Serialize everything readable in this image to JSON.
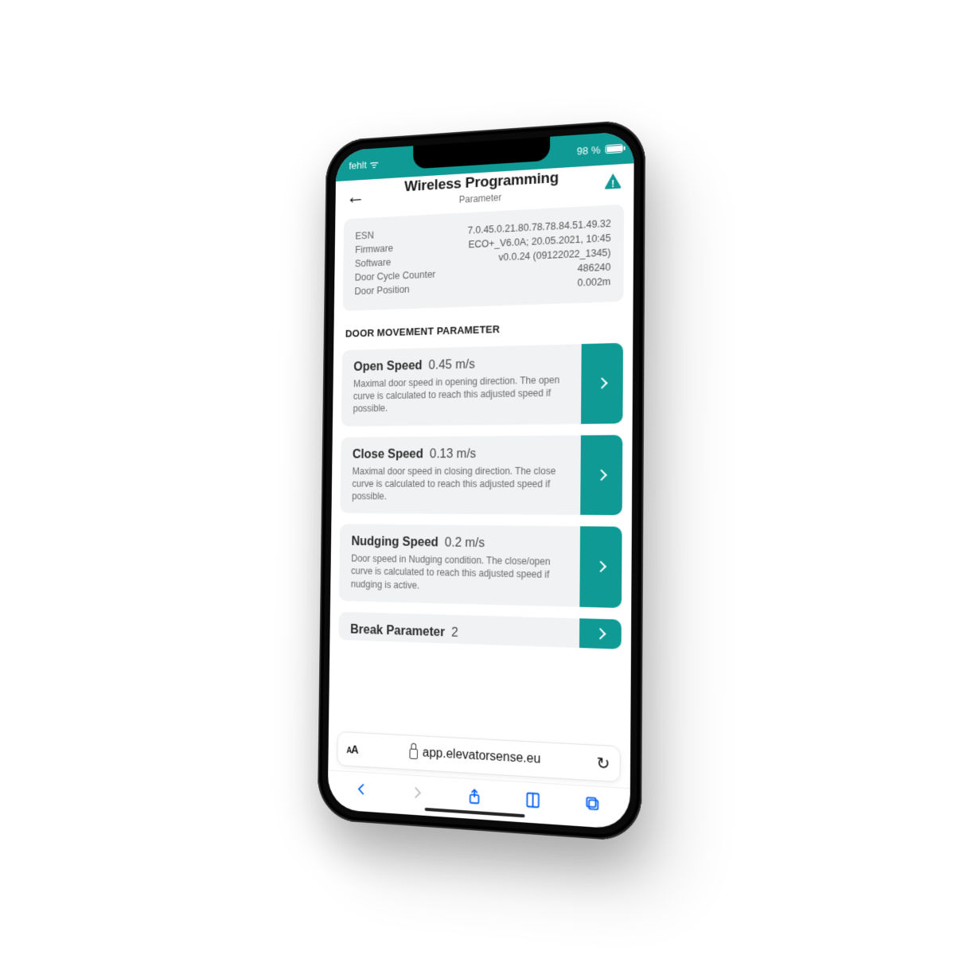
{
  "status": {
    "carrier": "fehlt",
    "battery_pct": "98 %"
  },
  "header": {
    "title": "Wireless Programming",
    "subtitle": "Parameter"
  },
  "info": {
    "rows": [
      {
        "k": "ESN",
        "v": "7.0.45.0.21.80.78.78.84.51.49.32"
      },
      {
        "k": "Firmware",
        "v": "ECO+_V6.0A; 20.05.2021, 10:45"
      },
      {
        "k": "Software",
        "v": "v0.0.24 (09122022_1345)"
      },
      {
        "k": "Door Cycle Counter",
        "v": "486240"
      },
      {
        "k": "Door Position",
        "v": "0.002m"
      }
    ]
  },
  "section_title": "DOOR MOVEMENT PARAMETER",
  "params": [
    {
      "name": "Open Speed",
      "value": "0.45 m/s",
      "desc": "Maximal door speed in opening direction. The open curve is calculated to reach this adjusted speed if possible."
    },
    {
      "name": "Close Speed",
      "value": "0.13 m/s",
      "desc": "Maximal door speed in closing direction. The close curve is calculated to reach this adjusted speed if possible."
    },
    {
      "name": "Nudging Speed",
      "value": "0.2 m/s",
      "desc": "Door speed in Nudging condition. The close/open curve is calculated to reach this adjusted speed if nudging is active."
    }
  ],
  "param_partial": {
    "name": "Break Parameter",
    "value": "2"
  },
  "browser": {
    "url": "app.elevatorsense.eu"
  },
  "colors": {
    "accent": "#0f9a96",
    "link": "#0b63f6"
  }
}
